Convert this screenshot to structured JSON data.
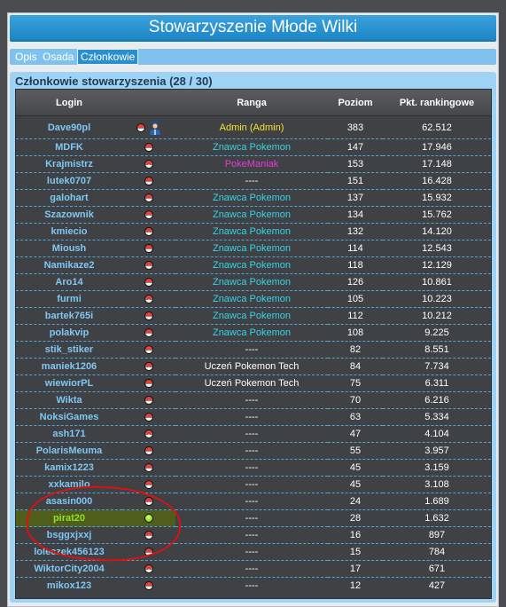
{
  "header": {
    "title": "Stowarzyszenie Młode Wilki"
  },
  "tabs": [
    {
      "label": "Opis",
      "active": false
    },
    {
      "label": "Osada",
      "active": false
    },
    {
      "label": "Członkowie",
      "active": true
    }
  ],
  "panel": {
    "title": "Członkowie stowarzyszenia (28 / 30)"
  },
  "table": {
    "columns": [
      "Login",
      "Ranga",
      "Poziom",
      "Pkt. rankingowe"
    ],
    "rows": [
      {
        "login": "Dave90pl",
        "rank": "Admin (Admin)",
        "rank_color": "#f2e62c",
        "level": "383",
        "points": "62.512",
        "admin": true
      },
      {
        "login": "MDFK",
        "rank": "Znawca Pokemon",
        "rank_color": "#36d4e8",
        "level": "147",
        "points": "17.946"
      },
      {
        "login": "Krajmistrz",
        "rank": "PokeManiak",
        "rank_color": "#e63cd8",
        "level": "153",
        "points": "17.148"
      },
      {
        "login": "lutek0707",
        "rank": "----",
        "rank_color": "#ffffff",
        "level": "151",
        "points": "16.428"
      },
      {
        "login": "galohart",
        "rank": "Znawca Pokemon",
        "rank_color": "#36d4e8",
        "level": "137",
        "points": "15.932"
      },
      {
        "login": "Szazownik",
        "rank": "Znawca Pokemon",
        "rank_color": "#36d4e8",
        "level": "134",
        "points": "15.762"
      },
      {
        "login": "kmiecio",
        "rank": "Znawca Pokemon",
        "rank_color": "#36d4e8",
        "level": "132",
        "points": "14.120"
      },
      {
        "login": "Mioush",
        "rank": "Znawca Pokemon",
        "rank_color": "#36d4e8",
        "level": "114",
        "points": "12.543"
      },
      {
        "login": "Namikaze2",
        "rank": "Znawca Pokemon",
        "rank_color": "#36d4e8",
        "level": "118",
        "points": "12.129"
      },
      {
        "login": "Aro14",
        "rank": "Znawca Pokemon",
        "rank_color": "#36d4e8",
        "level": "126",
        "points": "10.861"
      },
      {
        "login": "furmi",
        "rank": "Znawca Pokemon",
        "rank_color": "#36d4e8",
        "level": "105",
        "points": "10.223"
      },
      {
        "login": "bartek765i",
        "rank": "Znawca Pokemon",
        "rank_color": "#36d4e8",
        "level": "112",
        "points": "10.212"
      },
      {
        "login": "polakvip",
        "rank": "Znawca Pokemon",
        "rank_color": "#36d4e8",
        "level": "108",
        "points": "9.225"
      },
      {
        "login": "stik_stiker",
        "rank": "----",
        "rank_color": "#ffffff",
        "level": "82",
        "points": "8.551"
      },
      {
        "login": "maniek1206",
        "rank": "Uczeń Pokemon Tech",
        "rank_color": "#ffffff",
        "level": "84",
        "points": "7.734"
      },
      {
        "login": "wiewiorPL",
        "rank": "Uczeń Pokemon Tech",
        "rank_color": "#ffffff",
        "level": "75",
        "points": "6.311"
      },
      {
        "login": "Wikta",
        "rank": "----",
        "rank_color": "#ffffff",
        "level": "70",
        "points": "6.216"
      },
      {
        "login": "NoksiGames",
        "rank": "----",
        "rank_color": "#ffffff",
        "level": "63",
        "points": "5.334"
      },
      {
        "login": "ash171",
        "rank": "----",
        "rank_color": "#ffffff",
        "level": "47",
        "points": "4.104"
      },
      {
        "login": "PolarisMeuma",
        "rank": "----",
        "rank_color": "#ffffff",
        "level": "55",
        "points": "3.957"
      },
      {
        "login": "kamix1223",
        "rank": "----",
        "rank_color": "#ffffff",
        "level": "45",
        "points": "3.159"
      },
      {
        "login": "xxkamilo",
        "rank": "----",
        "rank_color": "#ffffff",
        "level": "45",
        "points": "3.108"
      },
      {
        "login": "asasin000",
        "rank": "----",
        "rank_color": "#ffffff",
        "level": "24",
        "points": "1.689"
      },
      {
        "login": "pirat20",
        "rank": "----",
        "rank_color": "#ffffff",
        "level": "28",
        "points": "1.632",
        "online": true,
        "highlighted": true
      },
      {
        "login": "bsggxjxxj",
        "rank": "----",
        "rank_color": "#ffffff",
        "level": "16",
        "points": "897"
      },
      {
        "login": "loleczek456123",
        "rank": "----",
        "rank_color": "#ffffff",
        "level": "15",
        "points": "784"
      },
      {
        "login": "WiktorCity2004",
        "rank": "----",
        "rank_color": "#ffffff",
        "level": "17",
        "points": "671"
      },
      {
        "login": "mikox123",
        "rank": "----",
        "rank_color": "#ffffff",
        "level": "12",
        "points": "427"
      }
    ]
  },
  "colors": {
    "login_link": "#7fc8f5",
    "online_login": "#8ee22a",
    "row_separator": "#4fa6dc",
    "annotation": "#d11111"
  }
}
